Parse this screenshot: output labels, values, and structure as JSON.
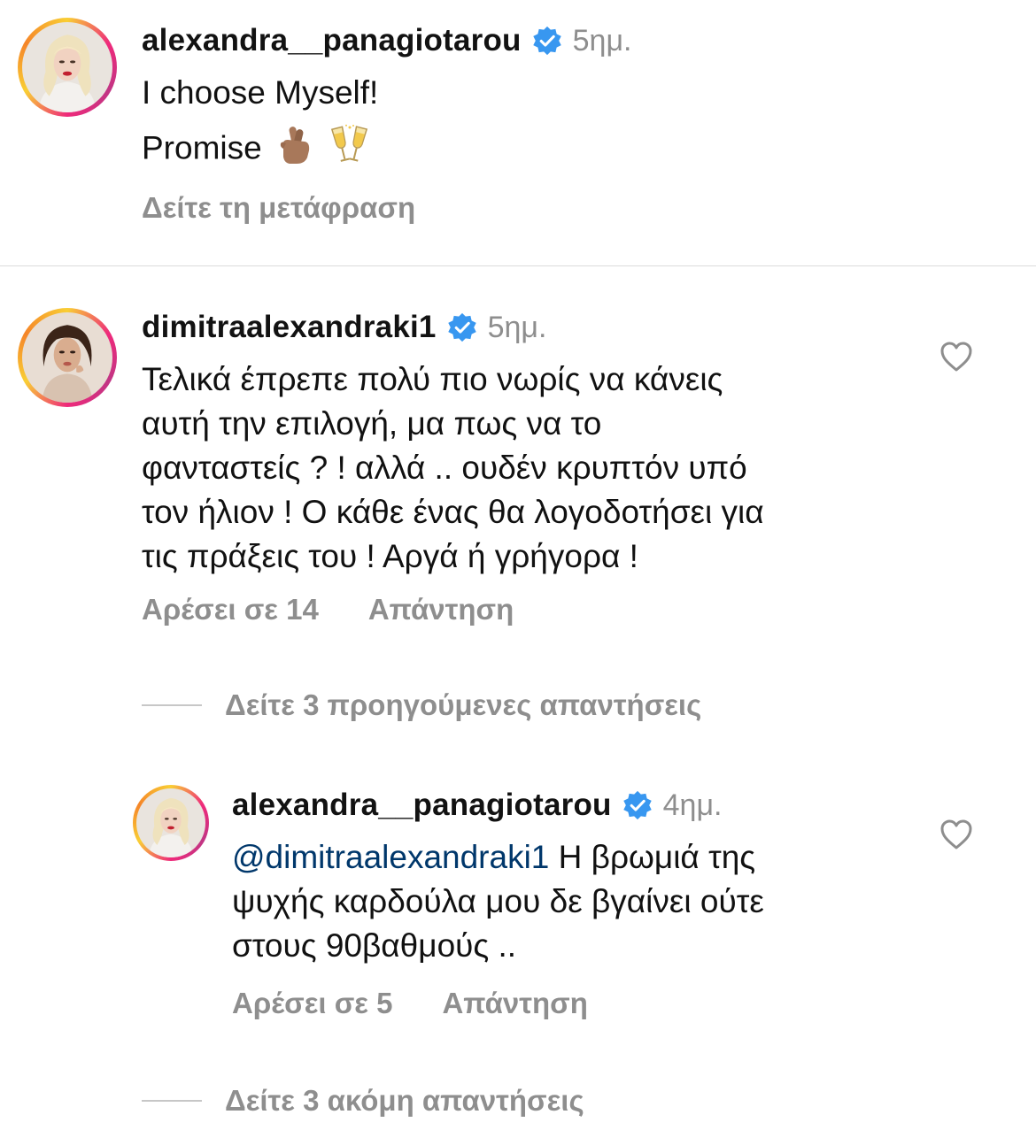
{
  "comments": [
    {
      "username": "alexandra__panagiotarou",
      "time": "5ημ.",
      "lines": [
        "I choose Myself!",
        "Promise"
      ],
      "translation": "Δείτε τη μετάφραση",
      "avatar_icon": "profile-photo-blonde"
    },
    {
      "username": "dimitraalexandraki1",
      "time": "5ημ.",
      "lines": [
        "Τελικά έπρεπε πολύ πιο νωρίς να κάνεις",
        "αυτή την επιλογή, μα πως να το",
        "φανταστείς ? !  αλλά .. ουδέν κρυπτόν υπό",
        "τον ήλιον ! Ο κάθε ένας θα λογοδοτήσει για",
        "τις πράξεις του ! Αργά ή γρήγορα !"
      ],
      "likes": "Αρέσει σε 14",
      "reply": "Απάντηση",
      "view_previous": "Δείτε 3 προηγούμενες απαντήσεις",
      "avatar_icon": "profile-photo-brunette"
    }
  ],
  "reply": {
    "username": "alexandra__panagiotarou",
    "time": "4ημ.",
    "mention": "@dimitraalexandraki1",
    "line1_rest": " Η βρωμιά της",
    "lines": [
      "ψυχής καρδούλα μου δε βγαίνει ούτε",
      "στους 90βαθμούς .."
    ],
    "likes": "Αρέσει σε 5",
    "reply": "Απάντηση"
  },
  "view_more": "Δείτε 3 ακόμη απαντήσεις",
  "colors": {
    "verified": "#3897f0",
    "secondary_text": "#8e8e8e",
    "mention": "#00376b",
    "divider": "#dbdbdb"
  },
  "icons": {
    "verified": "verified-badge-icon",
    "like": "heart-outline-icon",
    "emoji_1": "crossed-fingers-emoji",
    "emoji_2": "clinking-glasses-emoji"
  }
}
